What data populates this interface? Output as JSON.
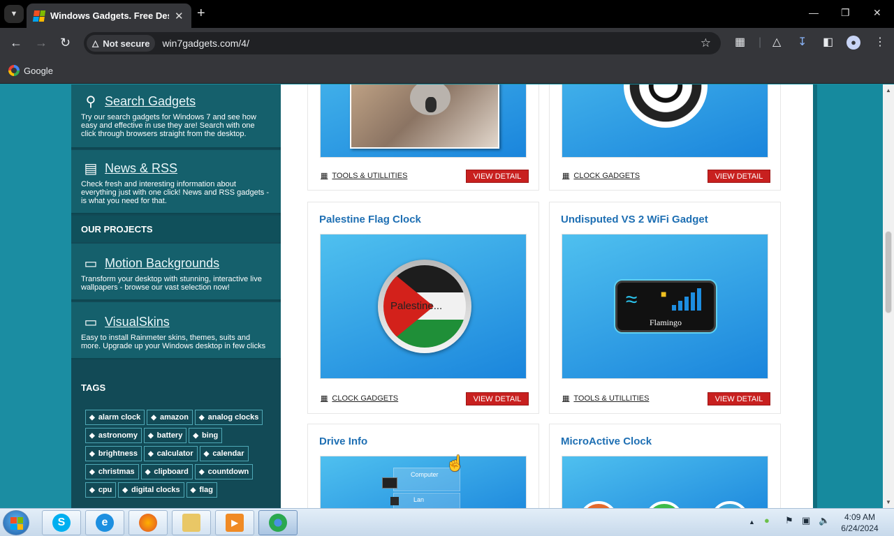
{
  "browser": {
    "tab_title": "Windows Gadgets. Free Deskto",
    "security_label": "Not secure",
    "url": "win7gadgets.com/4/",
    "bookmark_google": "Google"
  },
  "sidebar": {
    "blocks": [
      {
        "title": "Search Gadgets",
        "desc": "Try our search gadgets for Windows 7 and see how easy and effective in use they are! Search with one click through browsers straight from the desktop."
      },
      {
        "title": "News & RSS",
        "desc": "Check fresh and interesting information about everything just with one click! News and RSS gadgets - is what you need for that."
      },
      {
        "title": "Motion Backgrounds",
        "desc": "Transform your desktop with stunning, interactive live wallpapers - browse our vast selection now!"
      },
      {
        "title": "VisualSkins",
        "desc": "Easy to install Rainmeter skins, themes, suits and more. Upgrade up your Windows desktop in few clicks"
      }
    ],
    "our_projects": "OUR PROJECTS",
    "tags_title": "TAGS",
    "tags": [
      "alarm clock",
      "amazon",
      "analog clocks",
      "astronomy",
      "battery",
      "bing",
      "brightness",
      "calculator",
      "calendar",
      "christmas",
      "clipboard",
      "countdown",
      "cpu",
      "digital clocks",
      "flag"
    ]
  },
  "cards": [
    {
      "title": "",
      "category": "TOOLS & UTILLITIES",
      "button": "VIEW DETAIL"
    },
    {
      "title": "",
      "category": "CLOCK GADGETS",
      "button": "VIEW DETAIL"
    },
    {
      "title": "Palestine Flag Clock",
      "category": "CLOCK GADGETS",
      "button": "VIEW DETAIL",
      "thumb_text": "Palestine..."
    },
    {
      "title": "Undisputed VS 2 WiFi Gadget",
      "category": "TOOLS & UTILLITIES",
      "button": "VIEW DETAIL",
      "thumb_text": "Flamingo"
    },
    {
      "title": "Drive Info",
      "thumb_text_1": "Computer",
      "thumb_text_2": "Lan"
    },
    {
      "title": "MicroActive Clock"
    }
  ],
  "taskbar": {
    "time": "4:09 AM",
    "date": "6/24/2024"
  },
  "colors": {
    "accent_link": "#1e6fb3",
    "button_red": "#c8201f",
    "sidebar_bg": "#124a56",
    "page_bg": "#1b8da2"
  }
}
